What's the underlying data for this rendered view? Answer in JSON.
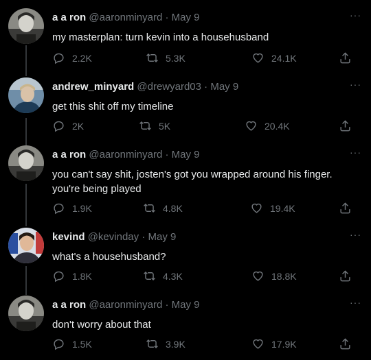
{
  "tweets": [
    {
      "name": "a a ron",
      "handle": "@aaronminyard",
      "date": "May 9",
      "text": "my masterplan: turn kevin into a househusband",
      "replies": "2.2K",
      "retweets": "5.3K",
      "likes": "24.1K"
    },
    {
      "name": "andrew_minyard",
      "handle": "@drewyard03",
      "date": "May 9",
      "text": "get this shit off my timeline",
      "replies": "2K",
      "retweets": "5K",
      "likes": "20.4K"
    },
    {
      "name": "a a ron",
      "handle": "@aaronminyard",
      "date": "May 9",
      "text": "you can't say shit, josten's got you wrapped around his finger. you're being played",
      "replies": "1.9K",
      "retweets": "4.8K",
      "likes": "19.4K"
    },
    {
      "name": "kevind",
      "handle": "@kevinday",
      "date": "May 9",
      "text": "what's a househusband?",
      "replies": "1.8K",
      "retweets": "4.3K",
      "likes": "18.8K"
    },
    {
      "name": "a a ron",
      "handle": "@aaronminyard",
      "date": "May 9",
      "text": "don't worry about that",
      "replies": "1.5K",
      "retweets": "3.9K",
      "likes": "17.9K"
    }
  ],
  "separator": "·",
  "more_glyph": "···",
  "icons": [
    "reply-icon",
    "retweet-icon",
    "like-icon",
    "share-icon",
    "more-icon"
  ],
  "colors": {
    "background": "#000000",
    "text": "#e7e9ea",
    "muted": "#71767b",
    "thread_line": "#333639"
  }
}
